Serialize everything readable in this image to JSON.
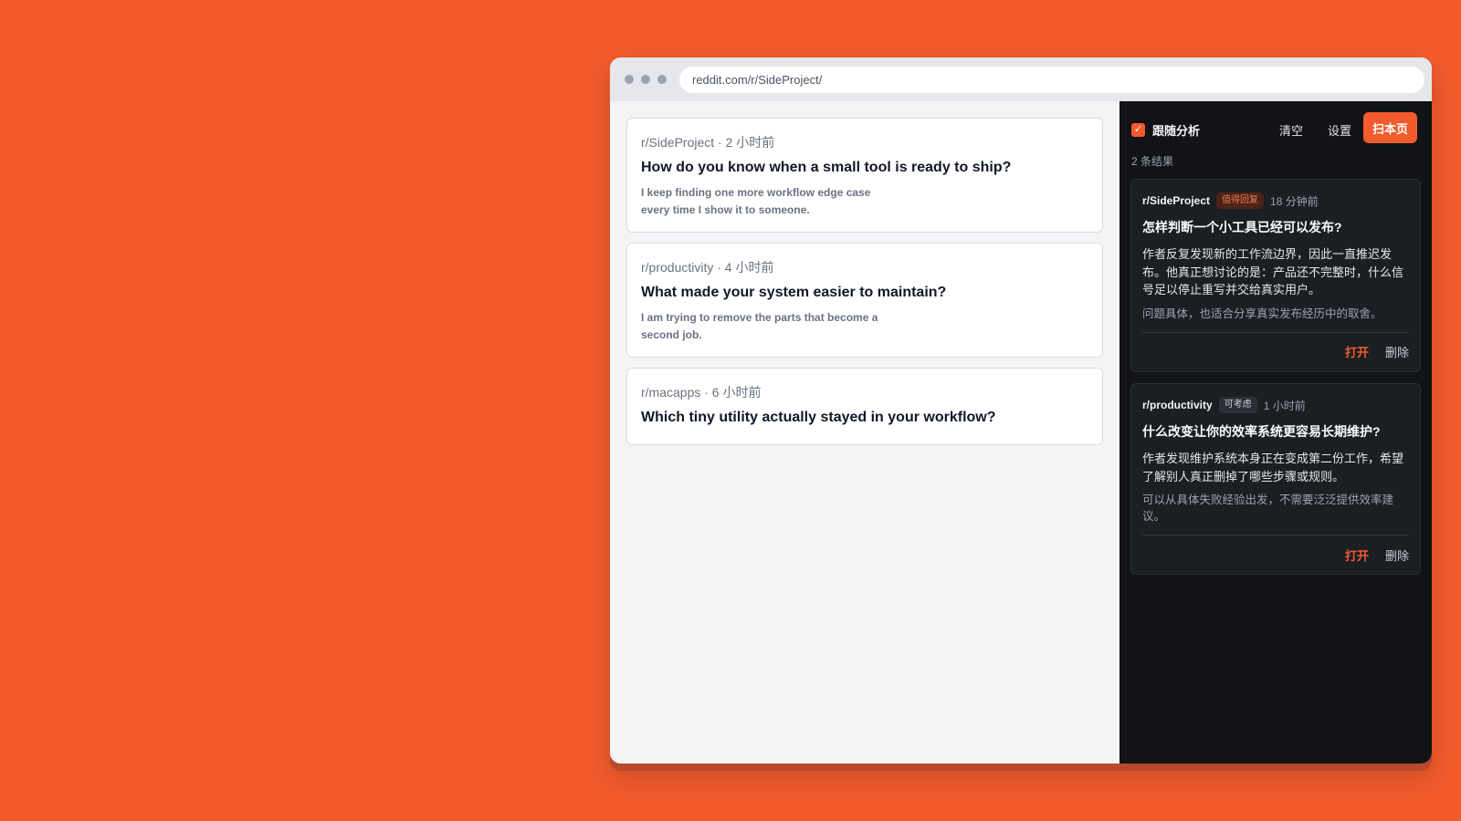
{
  "browser": {
    "url": "reddit.com/r/SideProject/"
  },
  "feed": {
    "posts": [
      {
        "meta": "r/SideProject · 2 小时前",
        "title": "How do you know when a small tool is ready to ship?",
        "body": "I keep finding one more workflow edge case every time I show it to someone."
      },
      {
        "meta": "r/productivity · 4 小时前",
        "title": "What made your system easier to maintain?",
        "body": "I am trying to remove the parts that become a second job."
      },
      {
        "meta": "r/macapps · 6 小时前",
        "title": "Which tiny utility actually stayed in your workflow?",
        "body": ""
      }
    ]
  },
  "panel": {
    "follow_label": "跟随分析",
    "follow_checked": true,
    "clear_label": "清空",
    "settings_label": "设置",
    "scan_label": "扫本页",
    "result_count": "2 条结果",
    "accent_color": "#f35b2c",
    "results": [
      {
        "subreddit": "r/SideProject",
        "tag": "值得回复",
        "time": "18 分钟前",
        "title": "怎样判断一个小工具已经可以发布?",
        "summary": "作者反复发现新的工作流边界，因此一直推迟发布。他真正想讨论的是：产品还不完整时，什么信号足以停止重写并交给真实用户。",
        "note": "问题具体，也适合分享真实发布经历中的取舍。",
        "open_label": "打开",
        "delete_label": "删除"
      },
      {
        "subreddit": "r/productivity",
        "tag": "可考虑",
        "time": "1 小时前",
        "title": "什么改变让你的效率系统更容易长期维护?",
        "summary": "作者发现维护系统本身正在变成第二份工作，希望了解别人真正删掉了哪些步骤或规则。",
        "note": "可以从具体失败经验出发，不需要泛泛提供效率建议。",
        "open_label": "打开",
        "delete_label": "删除"
      }
    ]
  }
}
